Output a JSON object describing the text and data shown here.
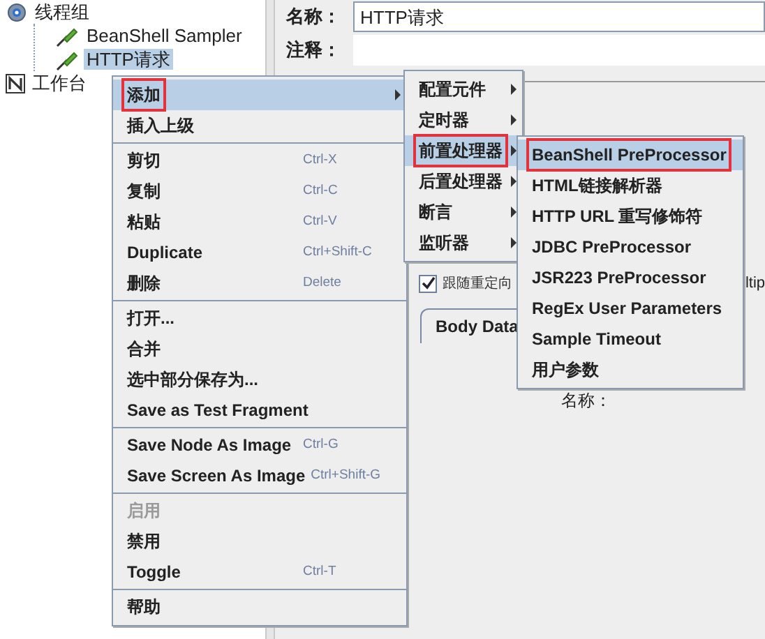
{
  "tree": [
    {
      "label": "线程组",
      "kind": "thread_group",
      "selected": false,
      "children": [
        {
          "label": "BeanShell Sampler",
          "kind": "sampler",
          "selected": false
        },
        {
          "label": "HTTP请求",
          "kind": "sampler",
          "selected": true
        }
      ]
    },
    {
      "label": "工作台",
      "kind": "workbench",
      "selected": false
    }
  ],
  "form": {
    "fields": [
      {
        "label": "名称：",
        "value": "HTTP请求"
      },
      {
        "label": "注释："
      }
    ]
  },
  "redirect_checkbox": {
    "label": "跟随重定向",
    "checked": true
  },
  "cut_text": "ltip",
  "tab": {
    "label": "Body Data"
  },
  "table_header": "名称：",
  "context_menu": [
    {
      "kind": "item",
      "label": "添加",
      "submenu": true,
      "selected": true,
      "outlined": true,
      "disabled": false
    },
    {
      "kind": "item",
      "label": "插入上级",
      "submenu": false,
      "selected": false,
      "outlined": false,
      "disabled": false
    },
    {
      "kind": "separator"
    },
    {
      "kind": "item",
      "label": "剪切",
      "shortcut": "Ctrl-X",
      "submenu": false,
      "selected": false,
      "outlined": false,
      "disabled": false
    },
    {
      "kind": "item",
      "label": "复制",
      "shortcut": "Ctrl-C",
      "submenu": false,
      "selected": false,
      "outlined": false,
      "disabled": false
    },
    {
      "kind": "item",
      "label": "粘贴",
      "shortcut": "Ctrl-V",
      "submenu": false,
      "selected": false,
      "outlined": false,
      "disabled": false
    },
    {
      "kind": "item",
      "label": "Duplicate",
      "shortcut": "Ctrl+Shift-C",
      "submenu": false,
      "selected": false,
      "outlined": false,
      "disabled": false
    },
    {
      "kind": "item",
      "label": "删除",
      "shortcut": "Delete",
      "submenu": false,
      "selected": false,
      "outlined": false,
      "disabled": false
    },
    {
      "kind": "separator"
    },
    {
      "kind": "item",
      "label": "打开...",
      "submenu": false,
      "selected": false,
      "outlined": false,
      "disabled": false
    },
    {
      "kind": "item",
      "label": "合并",
      "submenu": false,
      "selected": false,
      "outlined": false,
      "disabled": false
    },
    {
      "kind": "item",
      "label": "选中部分保存为...",
      "submenu": false,
      "selected": false,
      "outlined": false,
      "disabled": false
    },
    {
      "kind": "item",
      "label": "Save as Test Fragment",
      "submenu": false,
      "selected": false,
      "outlined": false,
      "disabled": false
    },
    {
      "kind": "separator"
    },
    {
      "kind": "item",
      "label": "Save Node As Image",
      "shortcut": "Ctrl-G",
      "submenu": false,
      "selected": false,
      "outlined": false,
      "disabled": false
    },
    {
      "kind": "item",
      "label": "Save Screen As Image",
      "shortcut": "Ctrl+Shift-G",
      "submenu": false,
      "selected": false,
      "outlined": false,
      "disabled": false
    },
    {
      "kind": "separator"
    },
    {
      "kind": "item",
      "label": "启用",
      "submenu": false,
      "selected": false,
      "outlined": false,
      "disabled": true
    },
    {
      "kind": "item",
      "label": "禁用",
      "submenu": false,
      "selected": false,
      "outlined": false,
      "disabled": false
    },
    {
      "kind": "item",
      "label": "Toggle",
      "shortcut": "Ctrl-T",
      "submenu": false,
      "selected": false,
      "outlined": false,
      "disabled": false
    },
    {
      "kind": "separator"
    },
    {
      "kind": "item",
      "label": "帮助",
      "submenu": false,
      "selected": false,
      "outlined": false,
      "disabled": false
    }
  ],
  "add_submenu": [
    {
      "kind": "item",
      "label": "配置元件",
      "submenu": true,
      "selected": false,
      "outlined": false,
      "disabled": false
    },
    {
      "kind": "item",
      "label": "定时器",
      "submenu": true,
      "selected": false,
      "outlined": false,
      "disabled": false
    },
    {
      "kind": "item",
      "label": "前置处理器",
      "submenu": true,
      "selected": true,
      "outlined": true,
      "disabled": false
    },
    {
      "kind": "item",
      "label": "后置处理器",
      "submenu": true,
      "selected": false,
      "outlined": false,
      "disabled": false
    },
    {
      "kind": "item",
      "label": "断言",
      "submenu": true,
      "selected": false,
      "outlined": false,
      "disabled": false
    },
    {
      "kind": "item",
      "label": "监听器",
      "submenu": true,
      "selected": false,
      "outlined": false,
      "disabled": false
    }
  ],
  "preprocessor_submenu": [
    {
      "kind": "item",
      "label": "BeanShell PreProcessor",
      "submenu": false,
      "selected": true,
      "outlined": true,
      "disabled": false
    },
    {
      "kind": "item",
      "label": "HTML链接解析器",
      "submenu": false,
      "selected": false,
      "outlined": false,
      "disabled": false
    },
    {
      "kind": "item",
      "label": "HTTP URL 重写修饰符",
      "submenu": false,
      "selected": false,
      "outlined": false,
      "disabled": false
    },
    {
      "kind": "item",
      "label": "JDBC PreProcessor",
      "submenu": false,
      "selected": false,
      "outlined": false,
      "disabled": false
    },
    {
      "kind": "item",
      "label": "JSR223 PreProcessor",
      "submenu": false,
      "selected": false,
      "outlined": false,
      "disabled": false
    },
    {
      "kind": "item",
      "label": "RegEx User Parameters",
      "submenu": false,
      "selected": false,
      "outlined": false,
      "disabled": false
    },
    {
      "kind": "item",
      "label": "Sample Timeout",
      "submenu": false,
      "selected": false,
      "outlined": false,
      "disabled": false
    },
    {
      "kind": "item",
      "label": "用户参数",
      "submenu": false,
      "selected": false,
      "outlined": false,
      "disabled": false
    }
  ]
}
